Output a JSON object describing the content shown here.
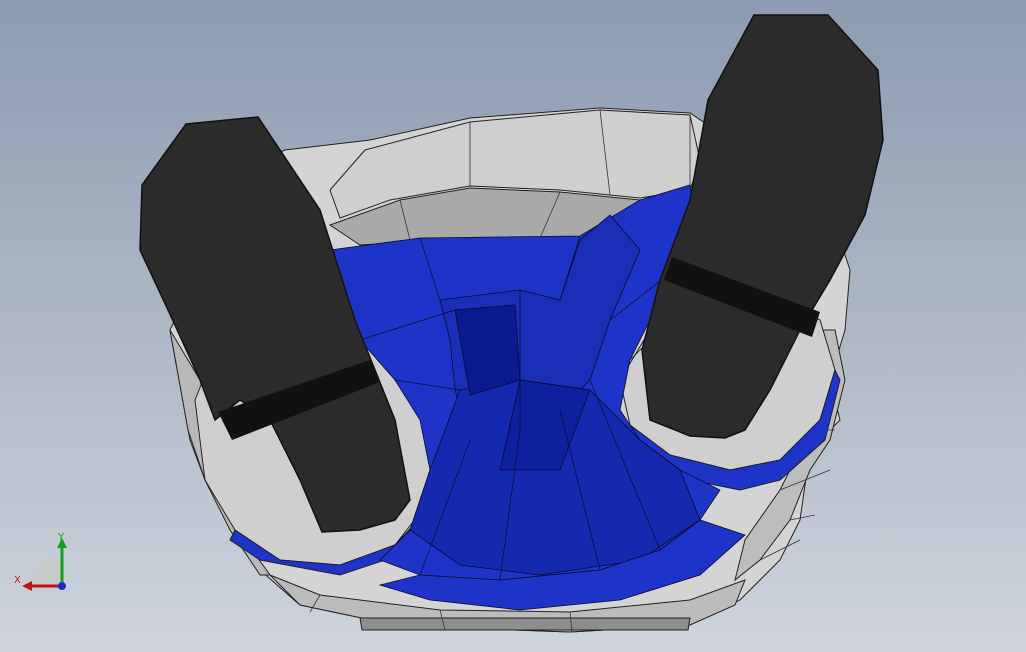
{
  "viewport": {
    "background_top": "#8c9bb0",
    "background_bottom": "#cfd4dc"
  },
  "model": {
    "colors": {
      "gray_surface": "#d9d9d9",
      "gray_shade": "#9c9c9c",
      "blue_surface": "#1e34c8",
      "blue_dark": "#0b1a8e",
      "dark_part": "#2b2b2b",
      "band": "#111111",
      "edge": "#111111"
    }
  },
  "triad": {
    "x_label": "X",
    "y_label": "Y",
    "x_color": "#c0141c",
    "y_color": "#14a01e",
    "z_color": "#1c2cc8"
  }
}
